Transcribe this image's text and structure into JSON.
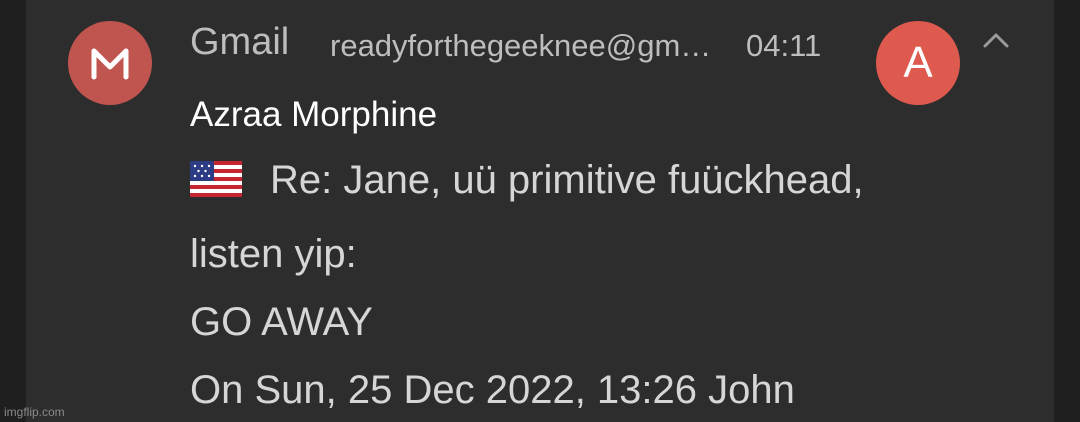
{
  "notification": {
    "app_name": "Gmail",
    "account": "readyforthegeeknee@gm…",
    "time": "04:11",
    "avatar_letter": "A",
    "sender": "Azraa Morphine",
    "flag_icon": "us-flag-emoji",
    "subject": "Re: Jane, uü primitive fuückhead,",
    "body_lines": [
      "listen yip:",
      "GO AWAY",
      "On Sun, 25 Dec 2022, 13:26 John"
    ]
  },
  "icons": {
    "app_icon": "gmail-icon",
    "collapse_icon": "chevron-up-icon"
  },
  "colors": {
    "card_background": "#2d2d2d",
    "app_icon_bg": "#c0554f",
    "avatar_bg": "#de5a4f",
    "primary_text": "#ffffff",
    "secondary_text": "#bdbdbd"
  },
  "watermark": "imgflip.com"
}
